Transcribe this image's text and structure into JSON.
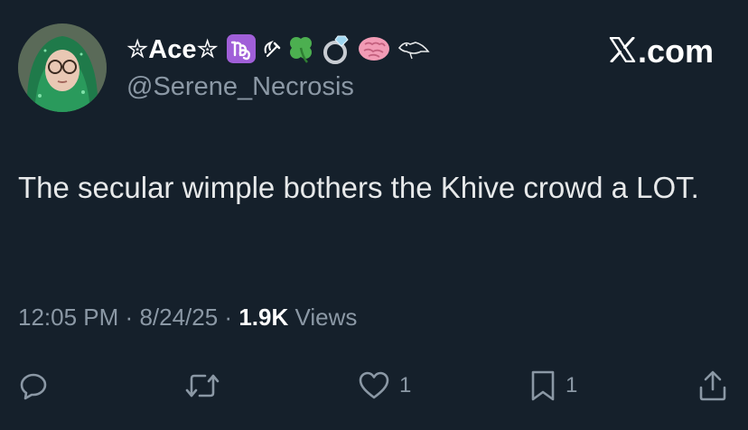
{
  "author": {
    "display_name": "✮Ace✮",
    "handle": "@Serene_Necrosis",
    "emoji_icons": [
      "capricorn-icon",
      "hammer-sickle-icon",
      "four-leaf-clover-icon",
      "ring-icon",
      "brain-icon",
      "bird-icon"
    ]
  },
  "brand": {
    "label": ".com"
  },
  "tweet": {
    "text": "The secular wimple bothers the Khive crowd a LOT."
  },
  "meta": {
    "time": "12:05 PM",
    "date": "8/24/25",
    "views_count": "1.9K",
    "views_label": "Views",
    "separator": "·"
  },
  "actions": {
    "reply_count": "",
    "repost_count": "",
    "like_count": "1",
    "bookmark_count": "1"
  },
  "colors": {
    "background": "#15202b",
    "text_primary": "#e7e9ea",
    "text_secondary": "#8b98a5",
    "capricorn_purple": "#a05fd8"
  }
}
